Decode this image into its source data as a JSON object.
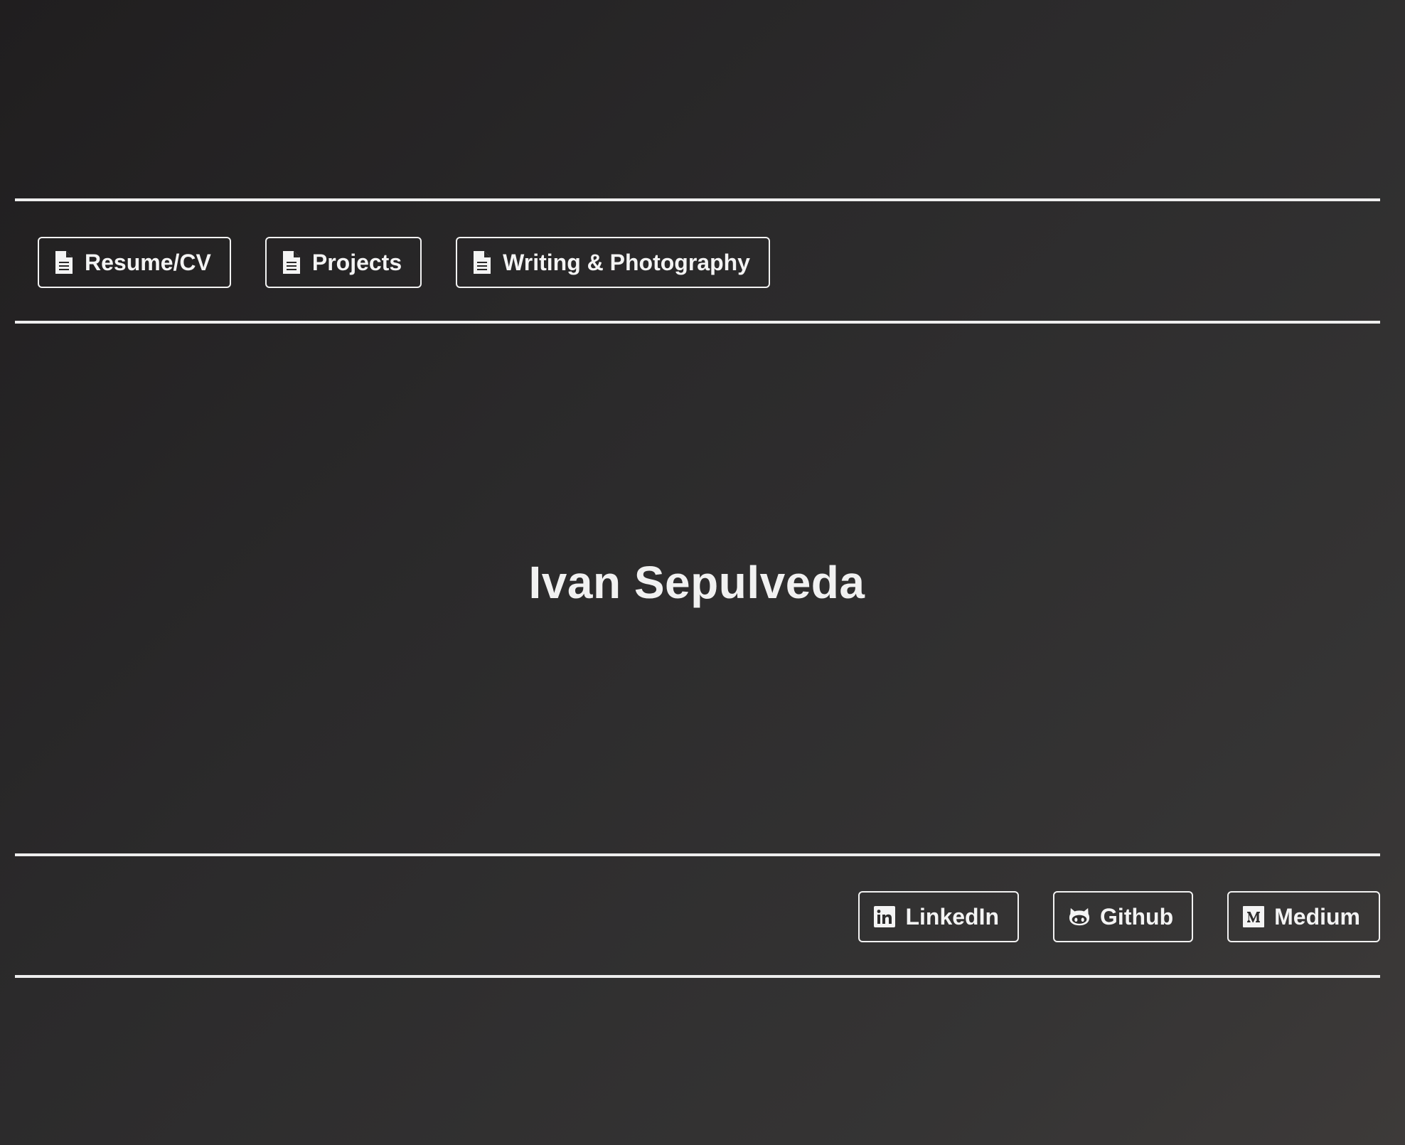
{
  "nav": {
    "items": [
      {
        "label": "Resume/CV",
        "icon": "document-icon"
      },
      {
        "label": "Projects",
        "icon": "document-icon"
      },
      {
        "label": "Writing & Photography",
        "icon": "document-icon"
      }
    ]
  },
  "hero": {
    "name": "Ivan Sepulveda"
  },
  "social": {
    "items": [
      {
        "label": "LinkedIn",
        "icon": "linkedin-icon"
      },
      {
        "label": "Github",
        "icon": "github-icon"
      },
      {
        "label": "Medium",
        "icon": "medium-icon"
      }
    ]
  },
  "colors": {
    "background_start": "#201e1f",
    "background_end": "#3d3a39",
    "foreground": "#f2f2f2"
  }
}
